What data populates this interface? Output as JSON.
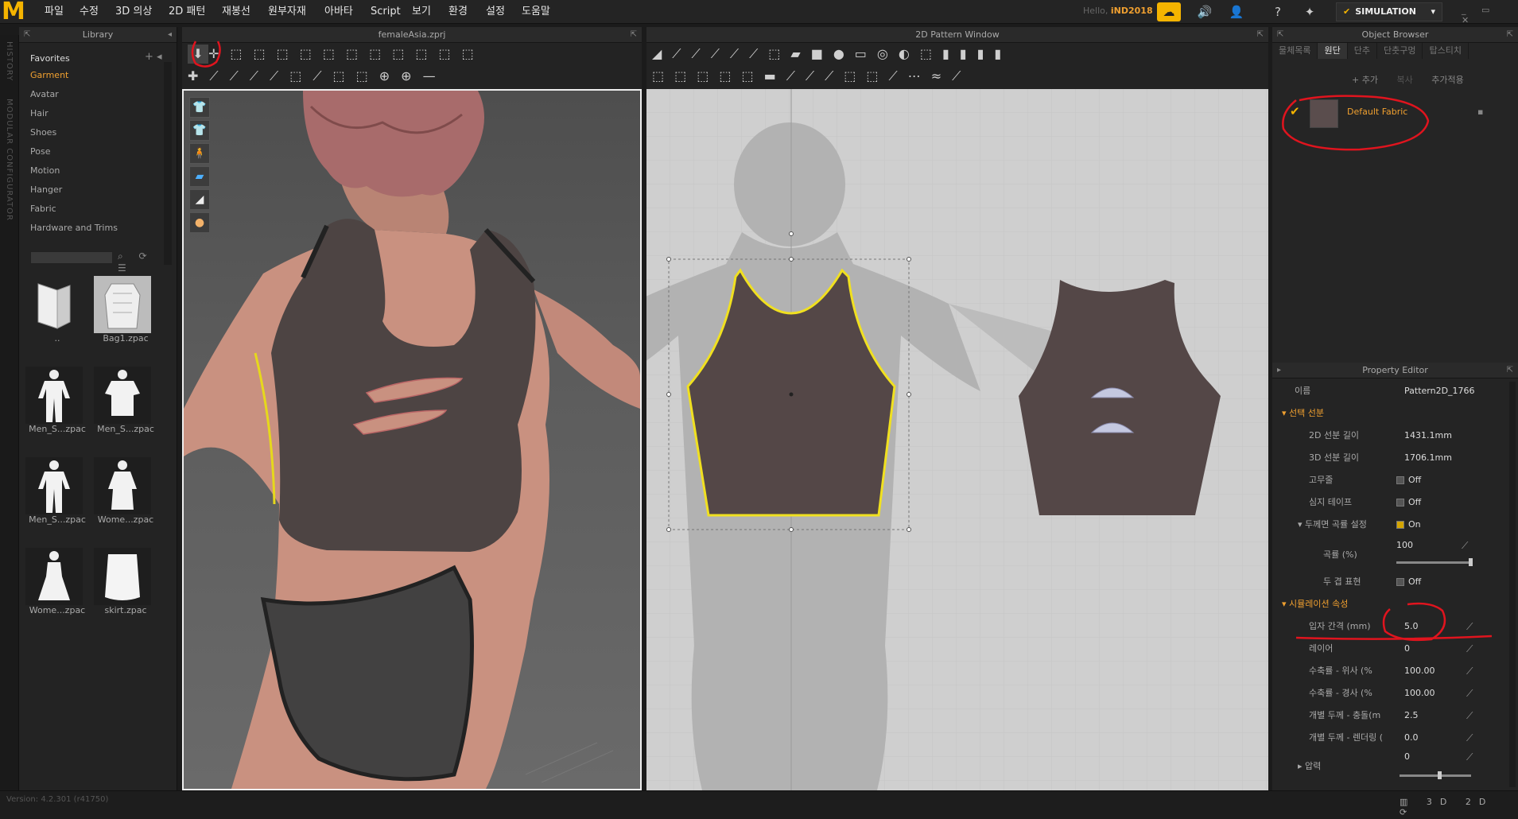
{
  "app": {
    "logo": "M"
  },
  "menu": [
    "파일",
    "수정",
    "3D 의상",
    "2D 패턴",
    "재봉선",
    "원부자재",
    "아바타",
    "Script",
    "보기",
    "환경",
    "설정",
    "도움말"
  ],
  "user": {
    "greeting": "Hello",
    "name": "iND2018"
  },
  "mode": {
    "label": "SIMULATION"
  },
  "history_sidebar": {
    "history": "HISTORY",
    "modular": "MODULAR CONFIGURATOR"
  },
  "library": {
    "title": "Library",
    "favorites": "Favorites",
    "items": [
      "Garment",
      "Avatar",
      "Hair",
      "Shoes",
      "Pose",
      "Motion",
      "Hanger",
      "Fabric",
      "Hardware and Trims"
    ],
    "files": [
      {
        "label": "..",
        "icon": "folder-icon"
      },
      {
        "label": "Bag1.zpac",
        "icon": "bag-icon"
      },
      {
        "label": "Men_S...zpac",
        "icon": "suit-icon"
      },
      {
        "label": "Men_S...zpac",
        "icon": "shirt-icon"
      },
      {
        "label": "Men_S...zpac",
        "icon": "suit-icon"
      },
      {
        "label": "Wome...zpac",
        "icon": "dress-icon"
      },
      {
        "label": "Wome...zpac",
        "icon": "dress-icon"
      },
      {
        "label": "skirt.zpac",
        "icon": "skirt-icon"
      }
    ]
  },
  "view3d": {
    "title": "femaleAsia.zprj"
  },
  "view2d": {
    "title": "2D Pattern Window"
  },
  "object_browser": {
    "title": "Object Browser",
    "tabs": [
      "물체목록",
      "원단",
      "단추",
      "단춧구멍",
      "탑스티치"
    ],
    "actions": [
      "+ 추가",
      "복사",
      "추가적용"
    ],
    "fabric_name": "Default Fabric"
  },
  "property_editor": {
    "title": "Property Editor",
    "name_label": "이름",
    "name_value": "Pattern2D_1766",
    "section_line": "선택 선분",
    "rows_line": [
      {
        "label": "2D 선분 길이",
        "value": "1431.1mm"
      },
      {
        "label": "3D 선분 길이",
        "value": "1706.1mm"
      },
      {
        "label": "고무줄",
        "value": "Off"
      },
      {
        "label": "심지 테이프",
        "value": "Off"
      },
      {
        "label": "두께면 곡률 설정",
        "value": "On"
      },
      {
        "label": "곡률 (%)",
        "value": "100"
      },
      {
        "label": "두 겹 표현",
        "value": "Off"
      }
    ],
    "section_sim": "시뮬레이션 속성",
    "rows_sim": [
      {
        "label": "입자 간격 (mm)",
        "value": "5.0"
      },
      {
        "label": "레이어",
        "value": "0"
      },
      {
        "label": "수축률 - 위사 (%",
        "value": "100.00"
      },
      {
        "label": "수축률 - 경사 (%",
        "value": "100.00"
      },
      {
        "label": "개별 두께 - 충돌(m",
        "value": "2.5"
      },
      {
        "label": "개별 두께 - 렌더링 (",
        "value": "0.0"
      },
      {
        "label": "압력",
        "value": "0"
      }
    ]
  },
  "status": {
    "version": "Version: 4.2.301 (r41750)"
  },
  "colors": {
    "accent": "#f0a030",
    "fabric": "#544747",
    "highlight": "#f0e020",
    "annotation": "#e0141e"
  }
}
